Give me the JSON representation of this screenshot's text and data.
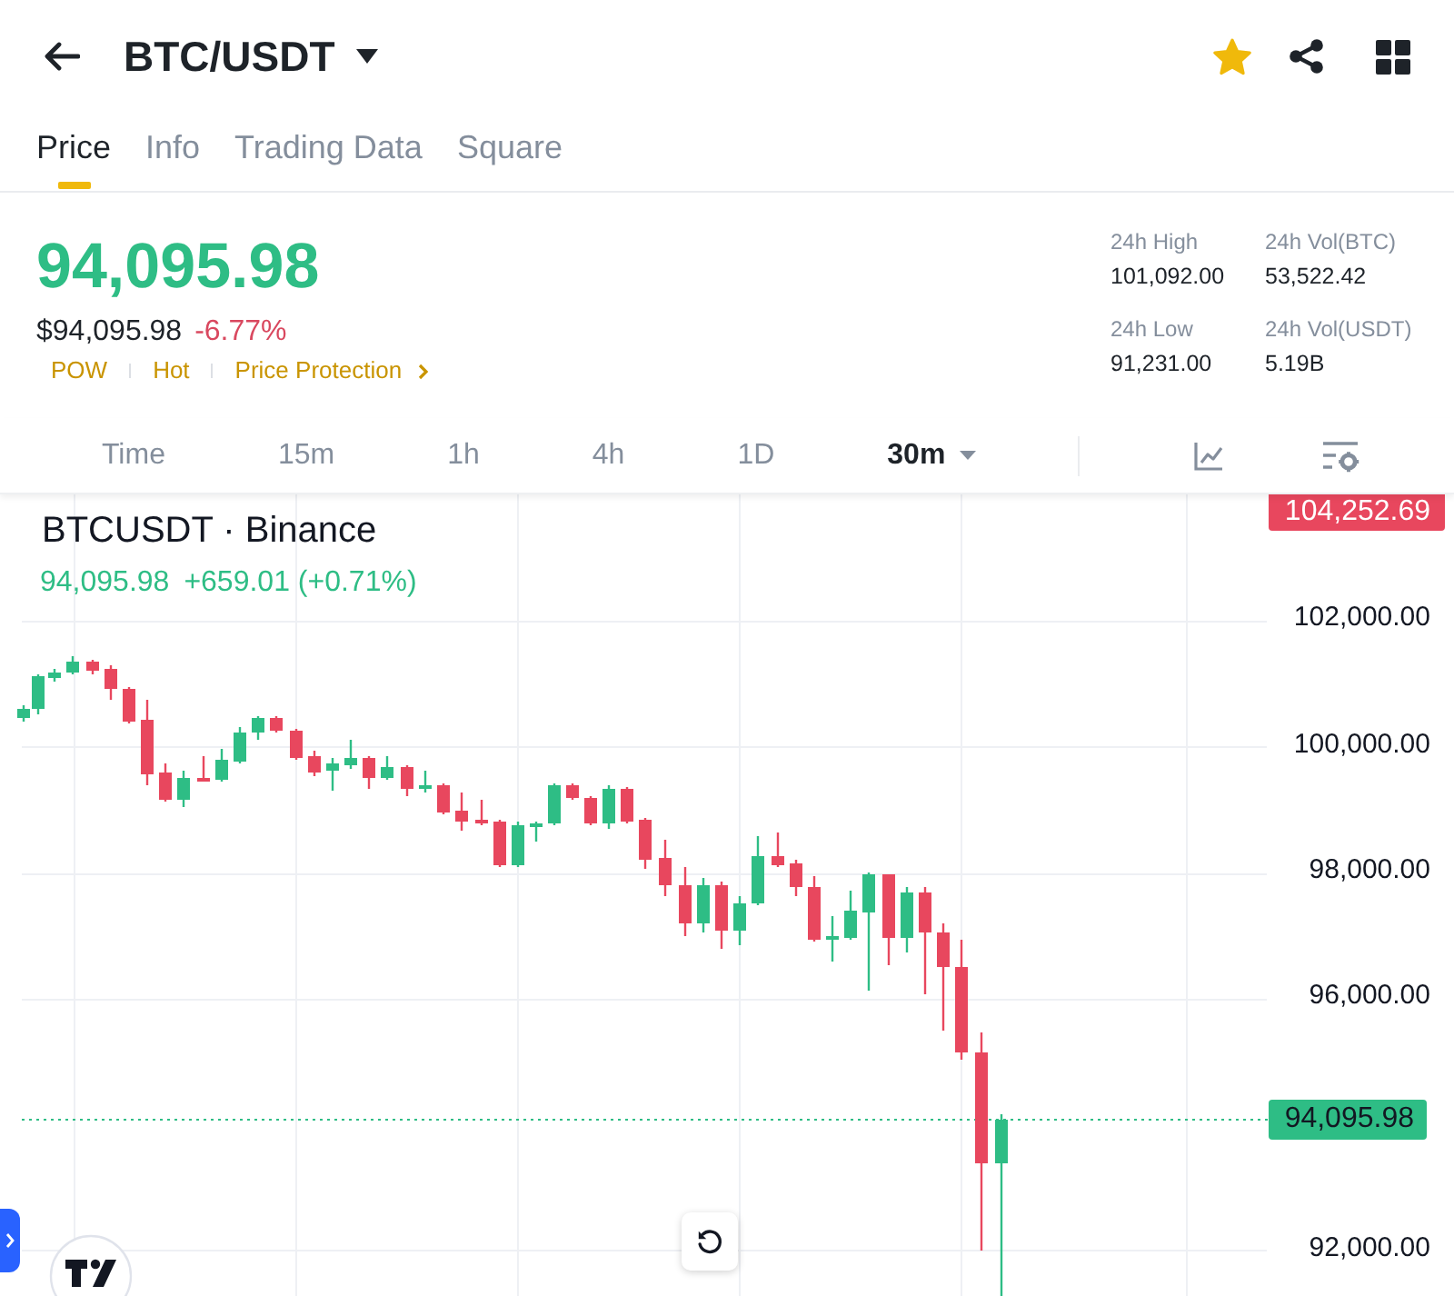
{
  "header": {
    "title": "BTC/USDT",
    "favorite": true
  },
  "tabs": [
    {
      "label": "Price",
      "selected": true
    },
    {
      "label": "Info",
      "selected": false
    },
    {
      "label": "Trading Data",
      "selected": false
    },
    {
      "label": "Square",
      "selected": false
    }
  ],
  "ticker": {
    "price": "94,095.98",
    "usd_price": "$94,095.98",
    "change": "-6.77%",
    "tags": [
      "POW",
      "Hot",
      "Price Protection"
    ]
  },
  "stats": [
    {
      "label": "24h High",
      "value": "101,092.00"
    },
    {
      "label": "24h Vol(BTC)",
      "value": "53,522.42"
    },
    {
      "label": "24h Low",
      "value": "91,231.00"
    },
    {
      "label": "24h Vol(USDT)",
      "value": "5.19B"
    }
  ],
  "intervals": [
    {
      "label": "Time",
      "selected": false,
      "kind": "option"
    },
    {
      "label": "15m",
      "selected": false,
      "kind": "option"
    },
    {
      "label": "1h",
      "selected": false,
      "kind": "option"
    },
    {
      "label": "4h",
      "selected": false,
      "kind": "option"
    },
    {
      "label": "1D",
      "selected": false,
      "kind": "option"
    },
    {
      "label": "30m",
      "selected": true,
      "kind": "menu"
    }
  ],
  "chart": {
    "symbol": "BTCUSDT · Binance",
    "last_price": "94,095.98",
    "change": "+659.01 (+0.71%)",
    "high_marker": "104,252.69",
    "price_marker": "94,095.98",
    "y_axis": [
      "102,000.00",
      "100,000.00",
      "98,000.00",
      "96,000.00",
      "92,000.00"
    ]
  }
}
